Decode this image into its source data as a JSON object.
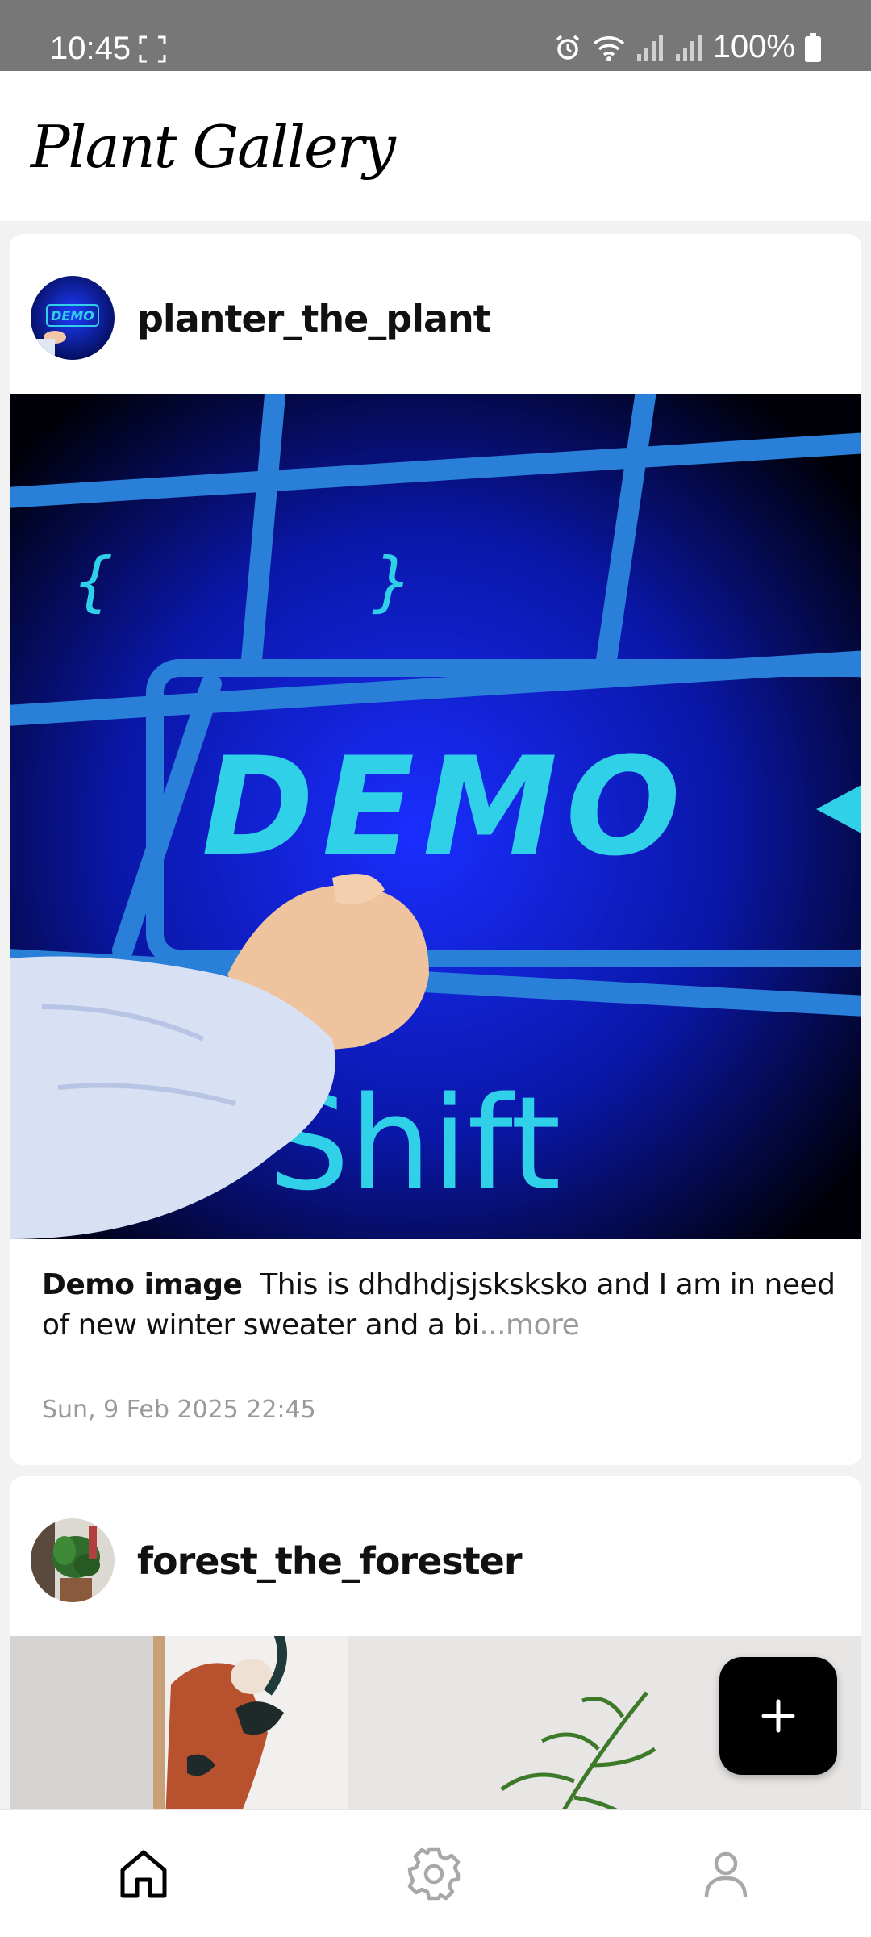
{
  "status_bar": {
    "time": "10:45",
    "battery": "100%"
  },
  "header": {
    "title": "Plant Gallery"
  },
  "posts": [
    {
      "username": "planter_the_plant",
      "caption_title": "Demo image",
      "caption_text": "This is dhdhdjsjsksksko and I am in need of new winter sweater and a bi",
      "more_label": "...more",
      "timestamp": "Sun, 9 Feb 2025  22:45",
      "image_text_main": "DEMO",
      "image_text_key": "Shift"
    },
    {
      "username": "forest_the_forester"
    }
  ],
  "fab": {
    "icon": "plus-icon"
  },
  "bottom_nav": {
    "items": [
      {
        "icon": "home-icon",
        "active": true
      },
      {
        "icon": "gear-icon",
        "active": false
      },
      {
        "icon": "person-icon",
        "active": false
      }
    ]
  },
  "colors": {
    "status_bar": "#777777",
    "demo_blue": "#0a1aa8",
    "demo_cyan": "#2fd0e8",
    "fab": "#000000",
    "muted_text": "#9a9a9a"
  }
}
